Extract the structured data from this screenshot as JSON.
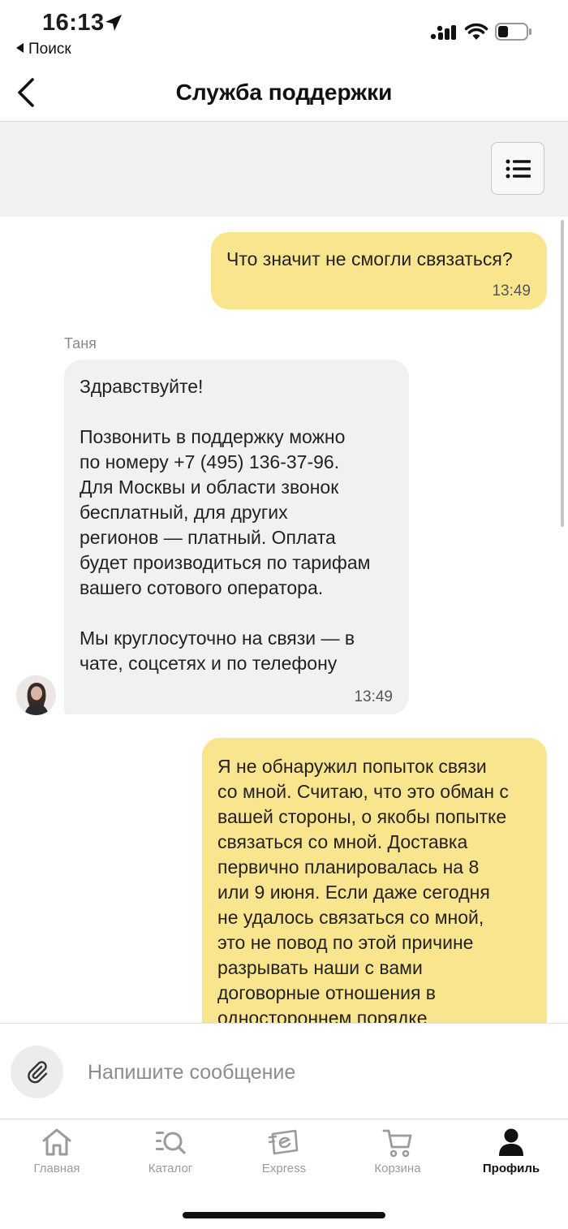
{
  "status_bar": {
    "time": "16:13",
    "back_app_label": "Поиск"
  },
  "header": {
    "title": "Служба поддержки"
  },
  "chat": {
    "messages": [
      {
        "direction": "outgoing",
        "text": "Что значит не смогли связаться?",
        "time": "13:49"
      },
      {
        "direction": "incoming",
        "sender": "Таня",
        "text": "Здравствуйте!\n\nПозвонить в поддержку можно\nпо номеру +7 (495) 136-37-96.\nДля Москвы и области звонок\nбесплатный, для других\nрегионов — платный. Оплата\nбудет производиться по тарифам\nвашего сотового оператора.\n\nМы круглосуточно на связи — в\nчате, соцсетях и по телефону",
        "time": "13:49"
      },
      {
        "direction": "outgoing",
        "text": "Я не обнаружил попыток связи\nсо мной. Считаю, что это обман с\nвашей стороны, о якобы попытке\nсвязаться со мной. Доставка\nпервично планировалась на 8\nили 9 июня. Если даже сегодня\nне удалось связаться со мной,\nэто не повод по этой причине\nразрывать наши с вами\nдоговорные отношения в\nодностороннем порядке"
      }
    ]
  },
  "composer": {
    "placeholder": "Напишите сообщение",
    "value": ""
  },
  "tabs": [
    {
      "label": "Главная",
      "icon": "home-icon",
      "active": false
    },
    {
      "label": "Каталог",
      "icon": "catalog-search-icon",
      "active": false
    },
    {
      "label": "Express",
      "icon": "express-icon",
      "active": false
    },
    {
      "label": "Корзина",
      "icon": "cart-icon",
      "active": false
    },
    {
      "label": "Профиль",
      "icon": "profile-icon",
      "active": true
    }
  ],
  "colors": {
    "outgoing_bubble": "#fae58f",
    "incoming_bubble": "#f1f1f1",
    "toolbar_bg": "#f2f2f2",
    "tab_inactive": "#9b9b9b",
    "tab_active": "#111111"
  }
}
